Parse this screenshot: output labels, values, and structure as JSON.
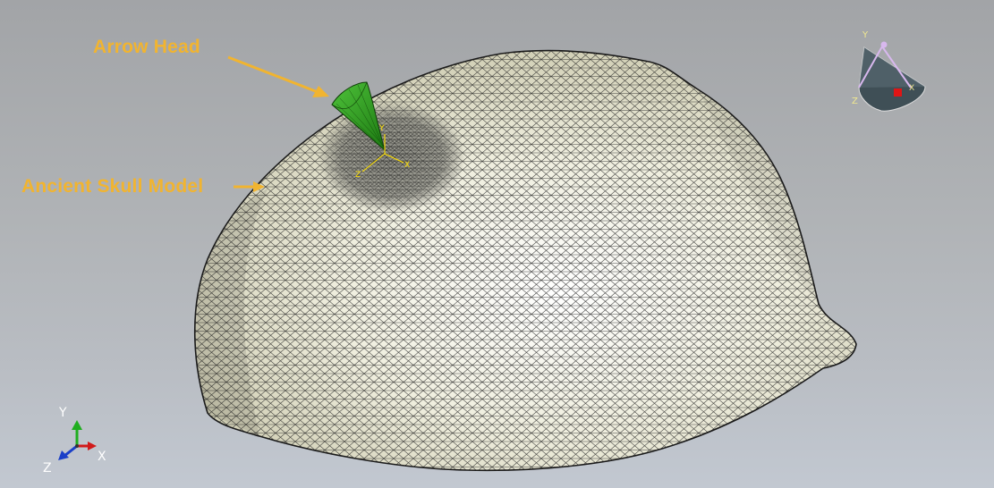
{
  "annotations": {
    "arrow_head": "Arrow Head",
    "skull_model": "Ancient Skull Model"
  },
  "triad": {
    "x": "X",
    "y": "Y",
    "z": "Z"
  },
  "view_cube": {
    "x": "X",
    "y": "Y",
    "z": "Z"
  },
  "local_axes": {
    "x": "X",
    "y": "Y",
    "z": "Z"
  },
  "colors": {
    "annotation": "#f1b430",
    "mesh_fill": "#ecead3",
    "mesh_edges": "#1a1a1a",
    "arrow_head": "#2f9b1f",
    "triad_x": "#d11a1a",
    "triad_y": "#1fae1f",
    "triad_z": "#1a3fc8"
  },
  "icons": {
    "triad": "xyz-axis-triad-icon",
    "view_cube": "view-orientation-cube-icon"
  }
}
